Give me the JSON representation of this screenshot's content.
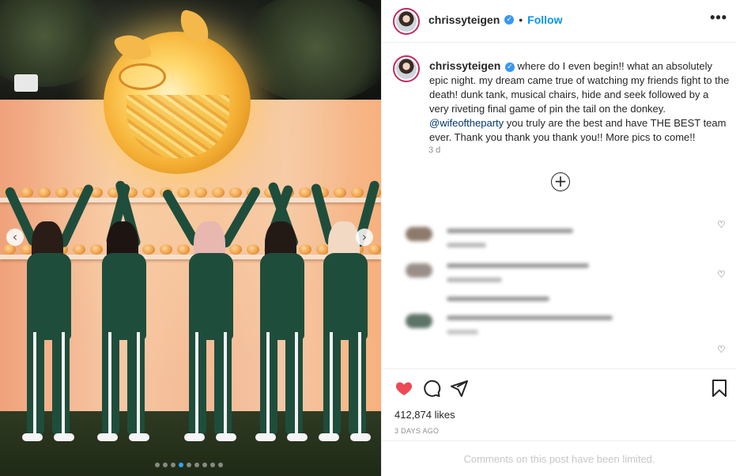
{
  "post": {
    "username": "chrissyteigen",
    "bullet": "•",
    "follow_label": "Follow",
    "more_label": "•••",
    "caption_prefix": "where do I even begin!! what an absolutely epic night. my dream came true of watching my friends fight to the death! dunk tank, musical chairs, hide and seek followed by a very riveting final game of pin the tail on the donkey. ",
    "caption_mention": "@wifeoftheparty",
    "caption_suffix": " you truly are the best and have THE BEST team ever. Thank you thank you thank you!! More pics to come!!",
    "caption_time": "3 d",
    "load_more_label": "+",
    "likes": "412,874 likes",
    "date": "3 DAYS AGO",
    "comments_limited": "Comments on this post have been limited.",
    "carousel_prev": "‹",
    "carousel_next": "›",
    "carousel_count": 9,
    "carousel_active": 4
  },
  "colors": {
    "accent": "#0095f6",
    "like_red": "#ed4956",
    "verified": "#3897f0",
    "tracksuit_green": "#1f4d3c"
  },
  "icons": {
    "like": "heart-filled-icon",
    "comment": "comment-bubble-icon",
    "share": "paper-plane-icon",
    "save": "bookmark-icon",
    "verified": "verified-badge-icon",
    "more": "more-options-icon"
  }
}
